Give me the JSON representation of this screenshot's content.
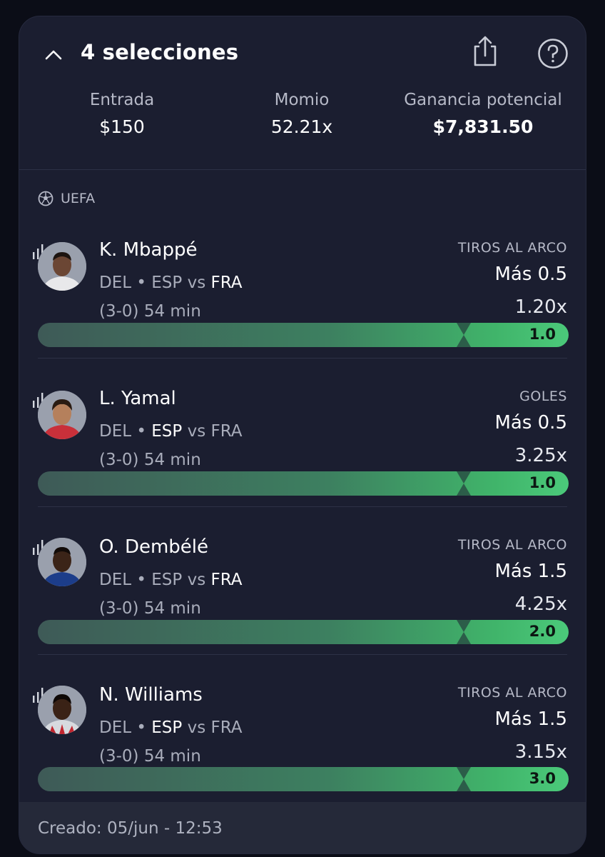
{
  "header": {
    "title": "4 selecciones",
    "collapse_icon": "chevron-up-icon",
    "share_icon": "share-icon",
    "help_icon": "help-icon"
  },
  "summary": {
    "entrada_label": "Entrada",
    "entrada_value": "$150",
    "momio_label": "Momio",
    "momio_value": "52.21x",
    "ganancia_label": "Ganancia potencial",
    "ganancia_value": "$7,831.50"
  },
  "league": {
    "name": "UEFA",
    "icon": "soccer-ball-icon"
  },
  "picks": [
    {
      "name": "K. Mbappé",
      "position": "DEL",
      "team_a": "ESP",
      "vs": "vs",
      "team_b": "FRA",
      "score": "(3-0)",
      "minute": "54 min",
      "market": "TIROS AL ARCO",
      "line": "Más 0.5",
      "odds": "1.20x",
      "progress_value": "1.0",
      "highlight": "team_b"
    },
    {
      "name": "L. Yamal",
      "position": "DEL",
      "team_a": "ESP",
      "vs": "vs",
      "team_b": "FRA",
      "score": "(3-0)",
      "minute": "54 min",
      "market": "GOLES",
      "line": "Más 0.5",
      "odds": "3.25x",
      "progress_value": "1.0",
      "highlight": "team_a"
    },
    {
      "name": "O. Dembélé",
      "position": "DEL",
      "team_a": "ESP",
      "vs": "vs",
      "team_b": "FRA",
      "score": "(3-0)",
      "minute": "54 min",
      "market": "TIROS AL ARCO",
      "line": "Más 1.5",
      "odds": "4.25x",
      "progress_value": "2.0",
      "highlight": "team_b"
    },
    {
      "name": "N. Williams",
      "position": "DEL",
      "team_a": "ESP",
      "vs": "vs",
      "team_b": "FRA",
      "score": "(3-0)",
      "minute": "54 min",
      "market": "TIROS AL ARCO",
      "line": "Más 1.5",
      "odds": "3.15x",
      "progress_value": "3.0",
      "highlight": "team_a"
    }
  ],
  "footer": {
    "created": "Creado: 05/jun - 12:53"
  },
  "colors": {
    "background": "#0b0d17",
    "card": "#1b1e30",
    "accent_green": "#4bc97a",
    "muted_text": "#a9adbb"
  }
}
